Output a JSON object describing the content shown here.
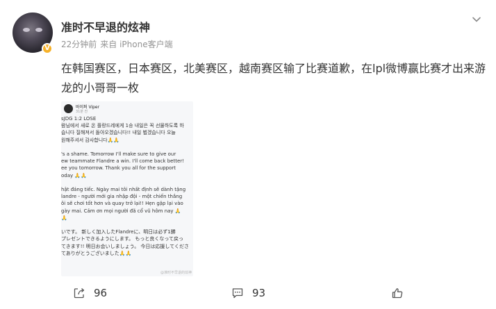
{
  "post": {
    "username": "准时不早退的炫神",
    "time": "22分钟前",
    "source": "来自 iPhone客户端",
    "text": "在韩国赛区，日本赛区，北美赛区，越南赛区输了比赛道歉，在lpl微博赢比赛才出来游龙的小哥哥一枚"
  },
  "image": {
    "author": "바이퍼 Viper",
    "time": "31분 전",
    "lines": [
      "sJDG 1:2 LOSE",
      "람님에서 새로 온 플랑드레에게 1승 내일은 꼭 선물하도록 하",
      "습니다 질해져서 돌아오겠습니다!! 내일 뵙겠습니다 오늘",
      "원해주셔서 감사합니다🙏🙏",
      "",
      "'s a shame. Tomorrow I'll make sure to give our",
      "ew teammate Flandre a win. I'll come back better!",
      "ee you tomorrow. Thank you all for the support",
      "oday 🙏🙏",
      "",
      "hật đáng tiếc. Ngày mai tôi nhất định sẽ dành tặng",
      "landre - người mới gia nhập đội - một chiến thắng",
      "ôi sẽ chơi tốt hơn và quay trở lại!! Hẹn gặp lại vào",
      "gày mai. Cảm ơn mọi người đã cổ vũ hôm nay 🙏",
      "🙏",
      "",
      "いです。 新しく加入したFlandreに、明日は必ず1勝",
      "プレゼントできるようにします。 もっと良くなって戻っ",
      "てきます!! 明日お会いしましょう。 今日は応援してくださ",
      "てありがとうございました🙏🙏"
    ],
    "watermark": "@准时不早退的炫神"
  },
  "actions": {
    "share_count": "96",
    "comment_count": "93",
    "like_count": ""
  },
  "colors": {
    "text": "#333333",
    "meta": "#939393",
    "badge": "#f6b128"
  }
}
